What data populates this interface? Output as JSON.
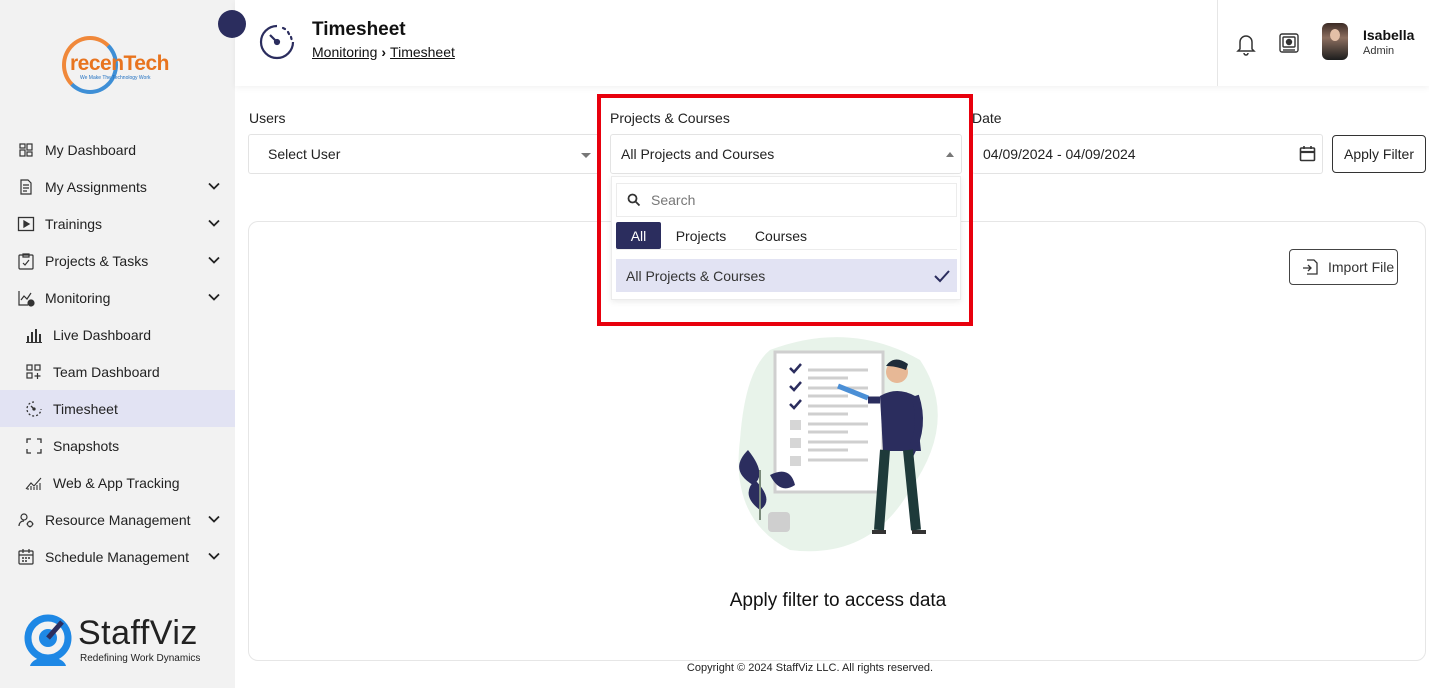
{
  "brand": {
    "logo_text": "recenTech",
    "logo_tagline": "We Make The Technology Work",
    "footer_logo_word": "StaffViz",
    "footer_logo_sub": "Redefining Work Dynamics"
  },
  "sidebar": {
    "items": [
      {
        "label": "My Dashboard",
        "icon": "dashboard-icon",
        "expandable": false
      },
      {
        "label": "My Assignments",
        "icon": "assignments-icon",
        "expandable": true
      },
      {
        "label": "Trainings",
        "icon": "training-icon",
        "expandable": true
      },
      {
        "label": "Projects & Tasks",
        "icon": "clipboard-icon",
        "expandable": true
      },
      {
        "label": "Monitoring",
        "icon": "monitoring-icon",
        "expandable": true
      },
      {
        "label": "Live Dashboard",
        "icon": "bar-chart-icon",
        "sub": true
      },
      {
        "label": "Team Dashboard",
        "icon": "grid-plus-icon",
        "sub": true
      },
      {
        "label": "Timesheet",
        "icon": "timer-icon",
        "sub": true,
        "active": true
      },
      {
        "label": "Snapshots",
        "icon": "snapshot-frame-icon",
        "sub": true
      },
      {
        "label": "Web & App Tracking",
        "icon": "trend-icon",
        "sub": true
      },
      {
        "label": "Resource Management",
        "icon": "resource-icon",
        "expandable": true
      },
      {
        "label": "Schedule Management",
        "icon": "calendar-icon",
        "expandable": true
      }
    ]
  },
  "header": {
    "title": "Timesheet",
    "breadcrumb": [
      "Monitoring",
      "Timesheet"
    ],
    "breadcrumb_sep": "›",
    "user_name": "Isabella",
    "user_role": "Admin"
  },
  "filters": {
    "users_label": "Users",
    "users_value": "Select User",
    "projects_label": "Projects & Courses",
    "projects_value": "All Projects and Courses",
    "date_label": "Date",
    "date_value": "04/09/2024 - 04/09/2024",
    "apply_label": "Apply Filter"
  },
  "dropdown": {
    "search_placeholder": "Search",
    "tabs": [
      "All",
      "Projects",
      "Courses"
    ],
    "active_tab": "All",
    "options": [
      "All Projects & Courses"
    ],
    "selected_option": "All Projects & Courses"
  },
  "content": {
    "import_label": "Import File",
    "empty_message": "Apply filter to access data"
  },
  "footer": {
    "copyright": "Copyright © 2024 StaffViz LLC. All rights reserved."
  },
  "colors": {
    "accent": "#2b2d5e",
    "active_bg": "#e2e3f3",
    "highlight": "#e8000d",
    "sidebar_bg": "#f2f2f2"
  }
}
